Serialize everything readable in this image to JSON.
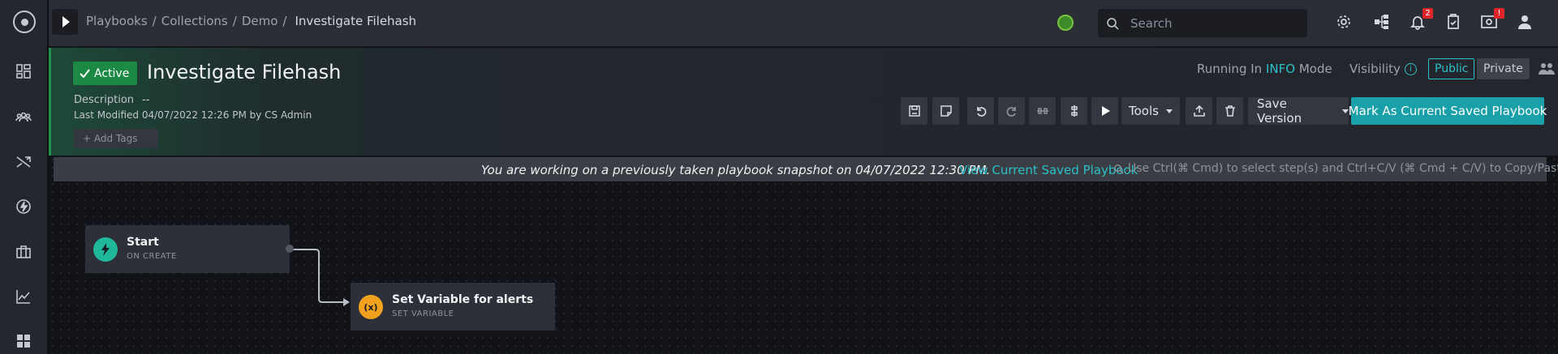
{
  "topbar": {
    "breadcrumb": [
      "Playbooks",
      "Collections",
      "Demo"
    ],
    "breadcrumb_current": "Investigate Filehash",
    "search_placeholder": "Search",
    "notifications_count": "2",
    "tasks_alert": "!"
  },
  "sidebar": {
    "items": [
      "dashboard-icon",
      "people-icon",
      "shuffle-icon",
      "bolt-icon",
      "briefcase-icon",
      "chart-icon",
      "apps-icon"
    ]
  },
  "header": {
    "status": "Active",
    "title": "Investigate Filehash",
    "description_label": "Description",
    "description_value": "--",
    "last_modified": "Last Modified 04/07/2022 12:26 PM by CS Admin",
    "add_tags": "+ Add Tags",
    "mode_prefix": "Running In",
    "mode_value": "INFO",
    "mode_suffix": "Mode",
    "visibility_label": "Visibility",
    "visibility_public": "Public",
    "visibility_private": "Private"
  },
  "toolbar": {
    "tools_label": "Tools",
    "save_version_label": "Save Version",
    "mark_current_label": "Mark As Current Saved Playbook"
  },
  "canvas": {
    "snapshot_notice": "You are working on a previously taken playbook snapshot on 04/07/2022 12:30 PM.",
    "snapshot_link": "View Current Saved Playbook",
    "hint": "Use Ctrl(⌘ Cmd) to select step(s) and Ctrl+C/V (⌘ Cmd + C/V) to Copy/Paste.",
    "nodes": [
      {
        "title": "Start",
        "subtitle": "ON CREATE",
        "icon": "bolt-icon",
        "color": "#1fb89a"
      },
      {
        "title": "Set Variable for alerts",
        "subtitle": "SET VARIABLE",
        "icon": "variable-icon",
        "color": "#f0a21f"
      }
    ]
  },
  "colors": {
    "accent": "#1aa0a8",
    "active": "#1c8a44",
    "background": "#111318"
  }
}
